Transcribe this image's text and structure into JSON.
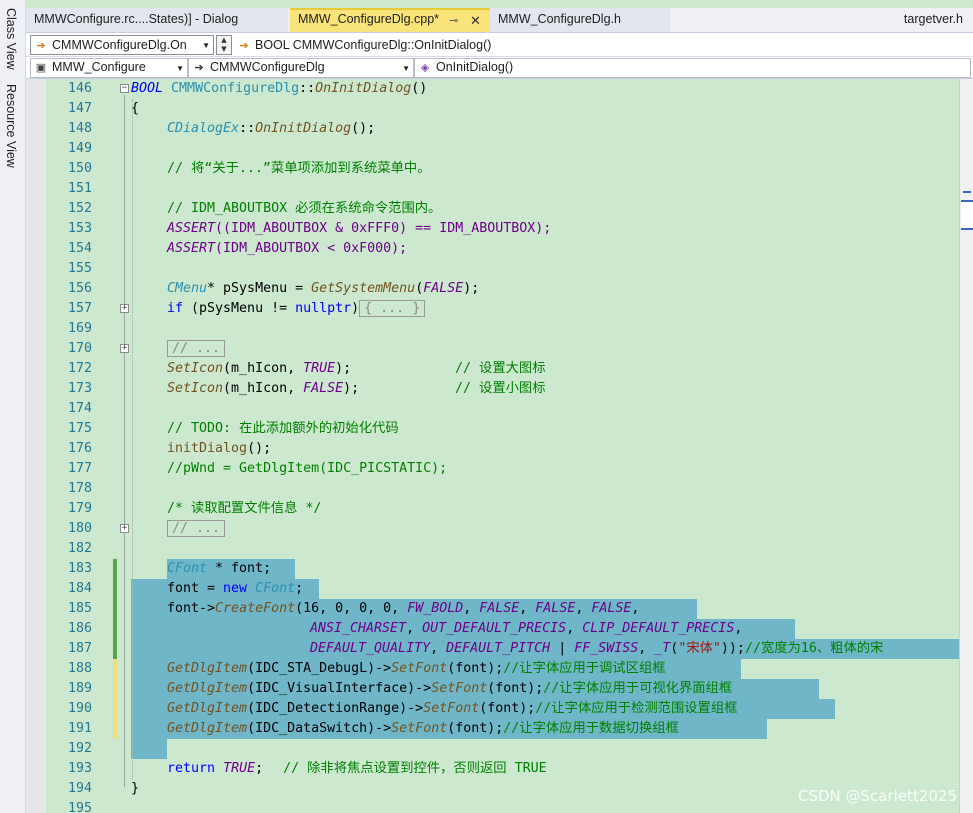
{
  "sidebar": {
    "class_view": "Class View",
    "resource_view": "Resource View"
  },
  "tabs": {
    "rc": "MMWConfigure.rc....States)] - Dialog",
    "cpp": "MMW_ConfigureDlg.cpp*",
    "h": "MMW_ConfigureDlg.h",
    "right": "targetver.h"
  },
  "nav1": {
    "class_combo": "CMMWConfigureDlg.On",
    "function_combo": "BOOL CMMWConfigureDlg::OnInitDialog()"
  },
  "nav2": {
    "project_combo": "MMW_Configure",
    "class_combo": "CMMWConfigureDlg",
    "function_combo": "OnInitDialog()"
  },
  "line_numbers": [
    "146",
    "147",
    "148",
    "149",
    "150",
    "151",
    "152",
    "153",
    "154",
    "155",
    "156",
    "157",
    "169",
    "170",
    "172",
    "173",
    "174",
    "175",
    "176",
    "177",
    "178",
    "179",
    "180",
    "182",
    "183",
    "184",
    "185",
    "186",
    "187",
    "188",
    "189",
    "190",
    "191",
    "192",
    "193",
    "194",
    "195"
  ],
  "code": {
    "l146": {
      "a": "BOOL",
      "b": "CMMWConfigureDlg",
      "c": "::",
      "d": "OnInitDialog",
      "e": "()"
    },
    "l147": "{",
    "l148": {
      "a": "CDialogEx",
      "b": "::",
      "c": "OnInitDialog",
      "d": "();"
    },
    "l150": "// 将“关于...”菜单项添加到系统菜单中。",
    "l152": "// IDM_ABOUTBOX 必须在系统命令范围内。",
    "l153": {
      "a": "ASSERT",
      "b": "((IDM_ABOUTBOX & 0xFFF0) == IDM_ABOUTBOX);"
    },
    "l154": {
      "a": "ASSERT",
      "b": "(IDM_ABOUTBOX < 0xF000);"
    },
    "l156": {
      "a": "CMenu",
      "b": "* pSysMenu = ",
      "c": "GetSystemMenu",
      "d": "(",
      "e": "FALSE",
      "f": ");"
    },
    "l157": {
      "a": "if",
      "b": " (pSysMenu != ",
      "c": "nullptr",
      "d": ")",
      "e": "{ ... }"
    },
    "l170": "// ...",
    "l172": {
      "a": "SetIcon",
      "b": "(m_hIcon, ",
      "c": "TRUE",
      "d": ");",
      "e": "// 设置大图标"
    },
    "l173": {
      "a": "SetIcon",
      "b": "(m_hIcon, ",
      "c": "FALSE",
      "d": ");",
      "e": "// 设置小图标"
    },
    "l175": "// TODO: 在此添加额外的初始化代码",
    "l176": {
      "a": "initDialog",
      "b": "();"
    },
    "l177": "//pWnd = GetDlgItem(IDC_PICSTATIC);",
    "l179": "/* 读取配置文件信息 */",
    "l180": "// ...",
    "l183": {
      "a": "CFont",
      "b": " * font;"
    },
    "l184": {
      "a": "font = ",
      "b": "new",
      "c": " ",
      "d": "CFont",
      "e": ";"
    },
    "l185": {
      "a": "font->",
      "b": "CreateFont",
      "c": "(16, 0, 0, 0, ",
      "d": "FW_BOLD",
      "e": ", ",
      "f": "FALSE",
      "g": ", ",
      "h": "FALSE",
      "i": ", ",
      "j": "FALSE",
      "k": ","
    },
    "l186": {
      "a": "ANSI_CHARSET",
      "b": ", ",
      "c": "OUT_DEFAULT_PRECIS",
      "d": ", ",
      "e": "CLIP_DEFAULT_PRECIS",
      "f": ","
    },
    "l187": {
      "a": "DEFAULT_QUALITY",
      "b": ", ",
      "c": "DEFAULT_PITCH",
      "d": " | ",
      "e": "FF_SWISS",
      "f": ", ",
      "g": "_T",
      "h": "(",
      "i": "\"宋体\"",
      "j": "));",
      "k": "//宽度为16、粗体的宋"
    },
    "l188": {
      "a": "GetDlgItem",
      "b": "(IDC_STA_DebugL)->",
      "c": "SetFont",
      "d": "(font);",
      "e": "//让字体应用于调试区组框"
    },
    "l189": {
      "a": "GetDlgItem",
      "b": "(IDC_VisualInterface)->",
      "c": "SetFont",
      "d": "(font);",
      "e": "//让字体应用于可视化界面组框"
    },
    "l190": {
      "a": "GetDlgItem",
      "b": "(IDC_DetectionRange)->",
      "c": "SetFont",
      "d": "(font);",
      "e": "//让字体应用于检测范围设置组框"
    },
    "l191": {
      "a": "GetDlgItem",
      "b": "(IDC_DataSwitch)->",
      "c": "SetFont",
      "d": "(font);",
      "e": "//让字体应用于数据切换组框"
    },
    "l193": {
      "a": "return",
      "b": " ",
      "c": "TRUE",
      "d": ";",
      "e": "// 除非将焦点设置到控件，否则返回 TRUE"
    },
    "l194": "}"
  },
  "watermark": "CSDN @Scarlett2025",
  "colors": {
    "editor_bg": "#cce8cf",
    "selection": "#6fb6c8",
    "active_tab": "#f9e47a"
  }
}
